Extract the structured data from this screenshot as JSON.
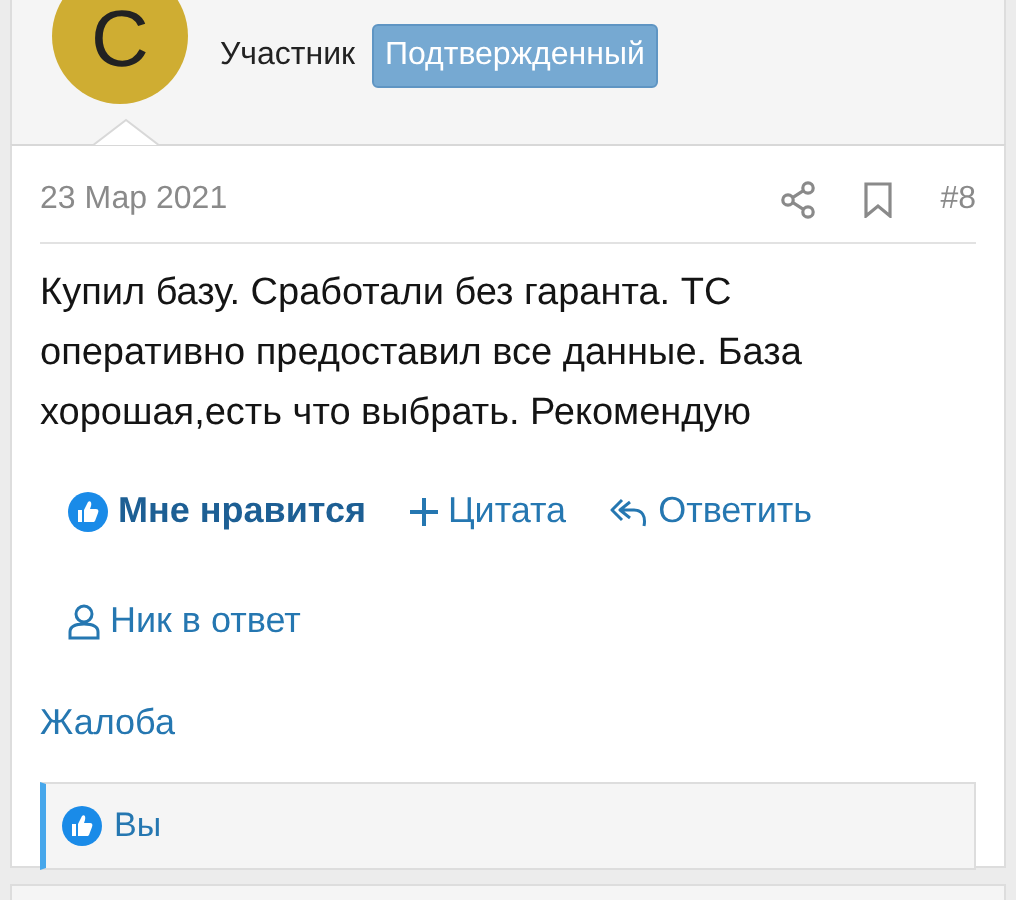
{
  "author": {
    "avatar_letter": "С",
    "role": "Участник",
    "badge": "Подтвержденный"
  },
  "post": {
    "date": "23 Мар 2021",
    "number": "#8",
    "text": "Купил базу. Сработали без гаранта. ТС оперативно предоставил все данные. База хорошая,есть что выбрать. Рекомендую"
  },
  "actions": [
    {
      "kind": "like",
      "label": "Мне нравится",
      "selected": true
    },
    {
      "kind": "quote",
      "label": "Цитата"
    },
    {
      "kind": "reply",
      "label": "Ответить"
    },
    {
      "kind": "mention",
      "label": "Ник в ответ"
    }
  ],
  "report": "Жалоба",
  "likes": {
    "text": "Вы"
  }
}
